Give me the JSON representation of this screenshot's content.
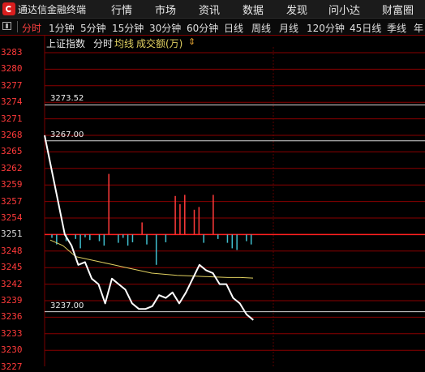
{
  "app": {
    "title": "通达信金融终端"
  },
  "menu": [
    "行情",
    "市场",
    "资讯",
    "数据",
    "发现",
    "问小达",
    "财富圈"
  ],
  "periods": [
    "分时",
    "1分钟",
    "5分钟",
    "15分钟",
    "30分钟",
    "60分钟",
    "日线",
    "周线",
    "月线",
    "120分钟",
    "45日线",
    "季线",
    "年"
  ],
  "active_period": "分时",
  "legend": {
    "index_name": "上证指数",
    "mode": "分时",
    "avg_line": "均线",
    "volume": "成交额(万)",
    "arrow": "⇕"
  },
  "colors": {
    "up": "#ff3a3a",
    "down": "#40c0d0",
    "price_line": "#ffffff",
    "avg_line": "#e0d060",
    "grid": "#8a0000",
    "base": "#ff2020"
  },
  "chart_data": {
    "type": "line",
    "title": "",
    "ylim": [
      3227,
      3283
    ],
    "yticks": [
      3283,
      3280,
      3277,
      3274,
      3271,
      3268,
      3265,
      3262,
      3259,
      3257,
      3254,
      3251,
      3248,
      3245,
      3242,
      3239,
      3236,
      3233,
      3230,
      3227
    ],
    "base_price": 3251,
    "reference_lines": [
      3273.52,
      3267.0,
      3237.0
    ],
    "reference_labels": [
      "3273.52",
      "3267.00",
      "3237.00"
    ],
    "series": [
      {
        "name": "",
        "values": [
          3268,
          3262,
          3257,
          3251,
          3249,
          3245.5,
          3246,
          3243,
          3242,
          3238.5,
          3243,
          3242,
          3241,
          3238.5,
          3237.5,
          3237.5,
          3238,
          3240,
          3239.5,
          3240.5,
          3238.5,
          3240.5,
          3243,
          3245.5,
          3244.5,
          3244,
          3242,
          3242,
          3239.5,
          3238.5,
          3236.5,
          3235.5
        ]
      },
      {
        "name": "",
        "values": [
          3250,
          3249,
          3247,
          3246.5,
          3246,
          3245.5,
          3245,
          3244.5,
          3244,
          3243.8,
          3243.6,
          3243.5,
          3243.4,
          3243.3,
          3243.2,
          3243.2,
          3243.1
        ]
      }
    ],
    "volume_bars": [
      -6,
      -18,
      0,
      -12,
      0,
      -8,
      -25,
      -5,
      -10,
      0,
      -12,
      -20,
      110,
      0,
      -15,
      -6,
      -20,
      -14,
      0,
      22,
      -18,
      0,
      -55,
      0,
      -14,
      0,
      70,
      55,
      72,
      0,
      45,
      50,
      -15,
      0,
      72,
      -8,
      0,
      -15,
      -25,
      -28,
      0,
      -12,
      -18
    ]
  }
}
